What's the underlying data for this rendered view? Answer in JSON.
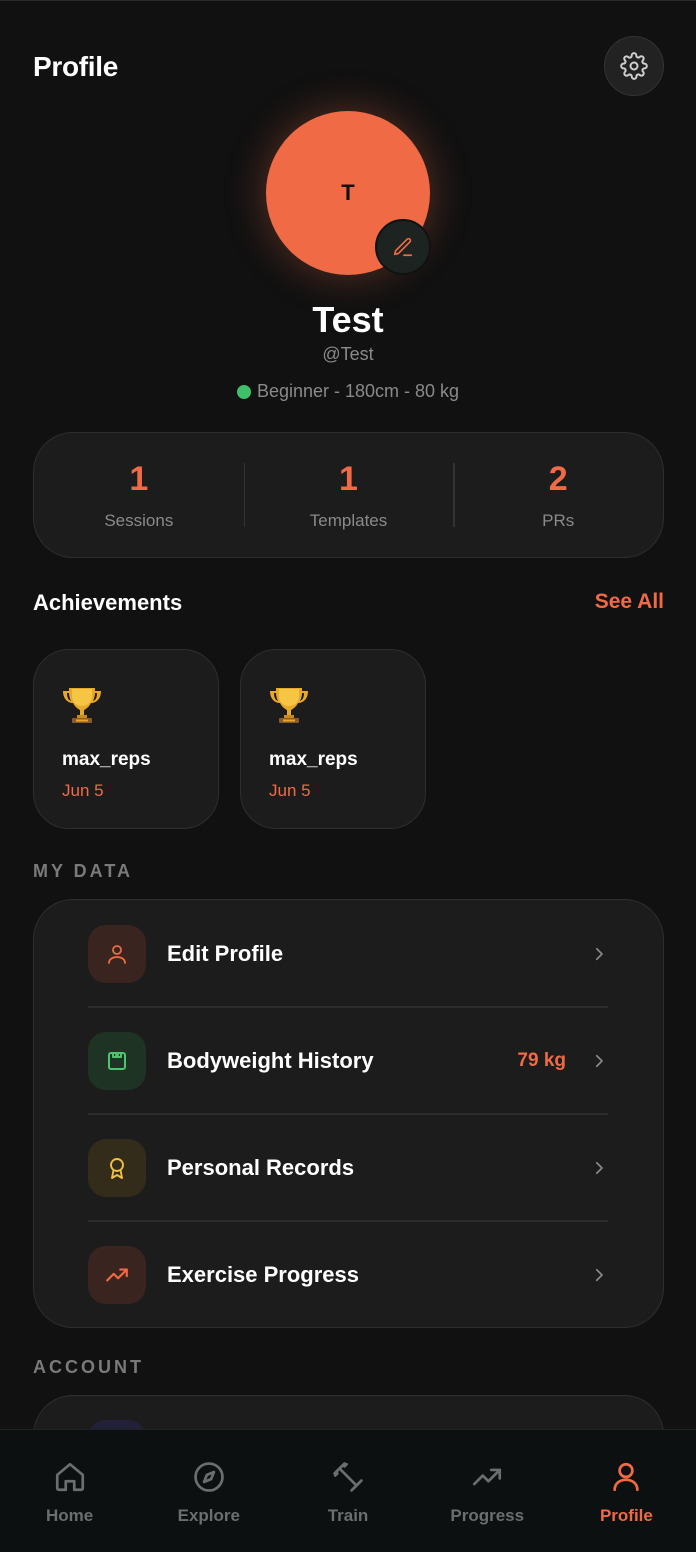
{
  "header": {
    "title": "Profile",
    "settings_icon": "gear-icon"
  },
  "profile": {
    "avatar_initial": "T",
    "name": "Test",
    "handle": "@Test",
    "meta": "Beginner - 180cm - 80 kg",
    "status_color": "#3fbf6a",
    "accent_color": "#ef6a45"
  },
  "stats": [
    {
      "value": "1",
      "label": "Sessions"
    },
    {
      "value": "1",
      "label": "Templates"
    },
    {
      "value": "2",
      "label": "PRs"
    }
  ],
  "achievements": {
    "title": "Achievements",
    "see_all": "See All",
    "items": [
      {
        "icon": "trophy-icon",
        "name": "max_reps",
        "date": "Jun 5"
      },
      {
        "icon": "trophy-icon",
        "name": "max_reps",
        "date": "Jun 5"
      }
    ]
  },
  "my_data": {
    "label": "MY DATA",
    "items": [
      {
        "icon": "user-icon",
        "label": "Edit Profile",
        "value": ""
      },
      {
        "icon": "scale-icon",
        "label": "Bodyweight History",
        "value": "79 kg"
      },
      {
        "icon": "award-icon",
        "label": "Personal Records",
        "value": ""
      },
      {
        "icon": "trending-up-icon",
        "label": "Exercise Progress",
        "value": ""
      }
    ]
  },
  "account": {
    "label": "ACCOUNT"
  },
  "nav": {
    "items": [
      {
        "icon": "home-icon",
        "label": "Home"
      },
      {
        "icon": "compass-icon",
        "label": "Explore"
      },
      {
        "icon": "dumbbell-icon",
        "label": "Train"
      },
      {
        "icon": "trending-up-icon",
        "label": "Progress"
      },
      {
        "icon": "user-icon",
        "label": "Profile"
      }
    ],
    "active": "Profile"
  }
}
